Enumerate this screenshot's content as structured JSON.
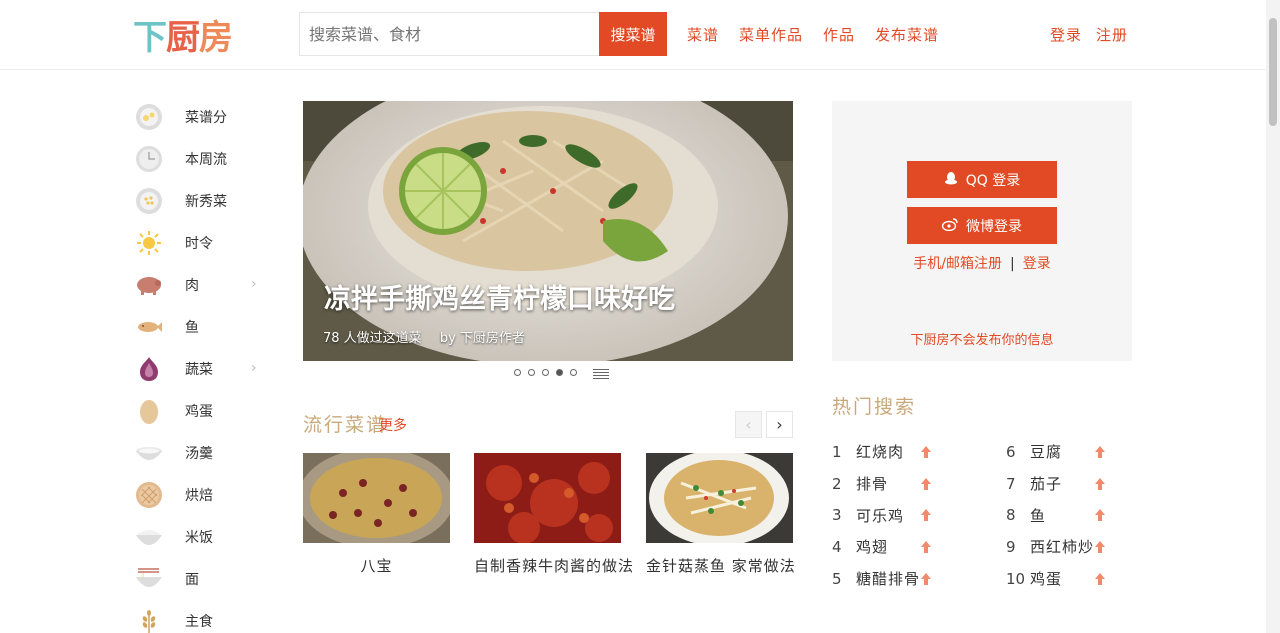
{
  "header": {
    "logo_chars": [
      "下",
      "厨",
      "房"
    ],
    "search_placeholder": "搜索菜谱、食材",
    "search_button": "搜菜谱",
    "nav": [
      "菜谱",
      "菜单作品",
      "作品",
      "发布菜谱"
    ],
    "auth": [
      "登录",
      "注册"
    ]
  },
  "sidebar": {
    "categories": [
      {
        "label": "菜谱分",
        "icon": "eggs-plate-icon",
        "has_submenu": false
      },
      {
        "label": "本周流",
        "icon": "clock-icon",
        "has_submenu": false
      },
      {
        "label": "新秀菜",
        "icon": "dots-plate-icon",
        "has_submenu": false
      },
      {
        "label": "时令",
        "icon": "sun-icon",
        "has_submenu": false
      },
      {
        "label": "肉",
        "icon": "pig-icon",
        "has_submenu": true
      },
      {
        "label": "鱼",
        "icon": "fish-icon",
        "has_submenu": false
      },
      {
        "label": "蔬菜",
        "icon": "onion-icon",
        "has_submenu": true
      },
      {
        "label": "鸡蛋",
        "icon": "egg-icon",
        "has_submenu": false
      },
      {
        "label": "汤羹",
        "icon": "soup-bowl-icon",
        "has_submenu": false
      },
      {
        "label": "烘焙",
        "icon": "waffle-icon",
        "has_submenu": false
      },
      {
        "label": "米饭",
        "icon": "rice-bowl-icon",
        "has_submenu": false
      },
      {
        "label": "面",
        "icon": "noodles-icon",
        "has_submenu": false
      },
      {
        "label": "主食",
        "icon": "wheat-icon",
        "has_submenu": false
      }
    ]
  },
  "hero": {
    "title": "凉拌手撕鸡丝青柠檬口味好吃",
    "stats": "78 人做过这道菜",
    "author": "by 下厨房作者",
    "slide_count": 5,
    "active_slide": 4
  },
  "popular": {
    "title": "流行菜谱",
    "more": "更多",
    "prev": "‹",
    "next": "›",
    "cards": [
      {
        "caption": "八宝"
      },
      {
        "caption": "自制香辣牛肉酱的做法"
      },
      {
        "caption": "金针菇蒸鱼 家常做法"
      }
    ]
  },
  "login": {
    "qq_button": "QQ 登录",
    "weibo_button": "微博登录",
    "register_link": "手机/邮箱注册",
    "separator": "|",
    "login_link": "登录",
    "note": "下厨房不会发布你的信息"
  },
  "ranking": {
    "title": "热门搜索",
    "items": [
      {
        "rank": "1",
        "term": "红烧肉"
      },
      {
        "rank": "2",
        "term": "排骨"
      },
      {
        "rank": "3",
        "term": "可乐鸡"
      },
      {
        "rank": "4",
        "term": "鸡翅"
      },
      {
        "rank": "5",
        "term": "糖醋排骨"
      },
      {
        "rank": "6",
        "term": "豆腐"
      },
      {
        "rank": "7",
        "term": "茄子"
      },
      {
        "rank": "8",
        "term": "鱼"
      },
      {
        "rank": "9",
        "term": "西红柿炒"
      },
      {
        "rank": "10",
        "term": "鸡蛋"
      }
    ]
  },
  "colors": {
    "accent": "#e14a24",
    "section_title": "#c9a97b",
    "panel_bg": "#f5f5f5"
  }
}
